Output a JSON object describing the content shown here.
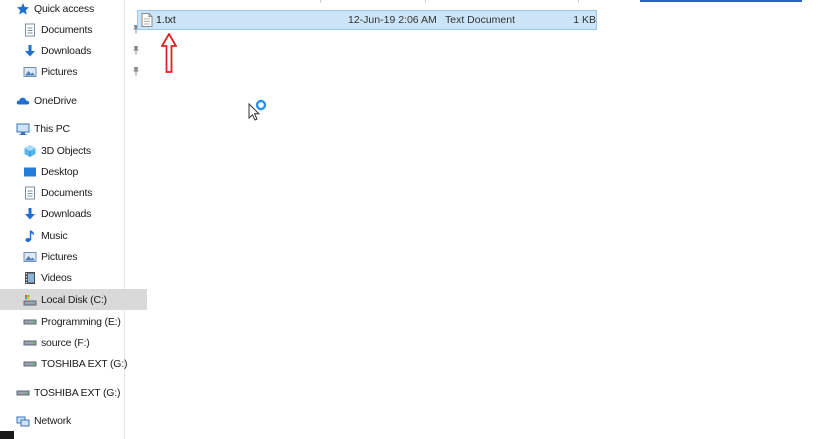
{
  "sidebar": {
    "quick_access": {
      "label": "Quick access",
      "items": [
        {
          "label": "Documents",
          "icon": "documents-icon",
          "pinned": true
        },
        {
          "label": "Downloads",
          "icon": "downloads-icon",
          "pinned": true
        },
        {
          "label": "Pictures",
          "icon": "pictures-icon",
          "pinned": true
        }
      ]
    },
    "onedrive": {
      "label": "OneDrive"
    },
    "this_pc": {
      "label": "This PC",
      "items": [
        {
          "label": "3D Objects",
          "icon": "3d-objects-icon"
        },
        {
          "label": "Desktop",
          "icon": "desktop-icon"
        },
        {
          "label": "Documents",
          "icon": "documents-icon"
        },
        {
          "label": "Downloads",
          "icon": "downloads-icon"
        },
        {
          "label": "Music",
          "icon": "music-icon"
        },
        {
          "label": "Pictures",
          "icon": "pictures-icon"
        },
        {
          "label": "Videos",
          "icon": "videos-icon"
        },
        {
          "label": "Local Disk (C:)",
          "icon": "local-disk-icon",
          "selected": true
        },
        {
          "label": "Programming (E:)",
          "icon": "drive-icon"
        },
        {
          "label": "source (F:)",
          "icon": "drive-icon"
        },
        {
          "label": "TOSHIBA EXT (G:)",
          "icon": "drive-icon"
        }
      ]
    },
    "external": {
      "label": "TOSHIBA EXT (G:)"
    },
    "network": {
      "label": "Network"
    }
  },
  "file_list": {
    "rows": [
      {
        "name": "1.txt",
        "date_modified": "12-Jun-19 2:06 AM",
        "type": "Text Document",
        "size": "1 KB",
        "selected": true
      }
    ]
  },
  "colors": {
    "selection_bg": "#cce4f7",
    "selection_border": "#99c9ef",
    "sidebar_selected": "#d9d9d9",
    "annotation_arrow": "#e02020",
    "accent": "#0078d7"
  }
}
